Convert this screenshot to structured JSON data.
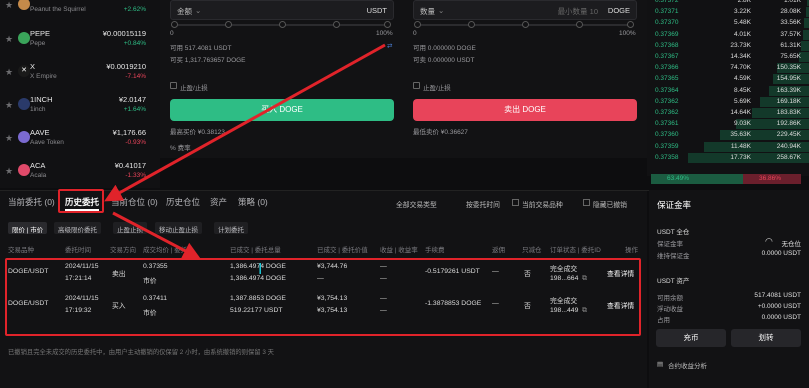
{
  "coins": [
    {
      "name": "Peanut the Squirrel",
      "symbol": "",
      "price": "",
      "change": "+2.62%",
      "color": "#c58a4a",
      "up": true
    },
    {
      "symbol": "PEPE",
      "name": "Pepe",
      "price": "¥0.00015119",
      "change": "+0.84%",
      "color": "#3aa45a",
      "up": true
    },
    {
      "symbol": "X",
      "name": "X Empire",
      "price": "¥0.0019210",
      "change": "-7.14%",
      "color": "#1a1a1a",
      "up": false
    },
    {
      "symbol": "1INCH",
      "name": "1inch",
      "price": "¥2.0147",
      "change": "+1.64%",
      "color": "#2a3a6a",
      "up": true
    },
    {
      "symbol": "AAVE",
      "name": "Aave Token",
      "price": "¥1,176.66",
      "change": "-0.93%",
      "color": "#7b6ad0",
      "up": false
    },
    {
      "symbol": "ACA",
      "name": "Acala",
      "price": "¥0.41017",
      "change": "-1.33%",
      "color": "#e04a6a",
      "up": false
    }
  ],
  "trade": {
    "buy": {
      "amount_label": "金额",
      "unit": "USDT",
      "available": "可用 517.4081 USDT",
      "can_buy": "可买 1,317.763657 DOGE",
      "pct_start": "0",
      "pct_end": "100%",
      "tpsl": "止盈/止损",
      "button": "买入 DOGE",
      "max_price": "最高买价 ¥0.38123",
      "fee": "% 费率"
    },
    "sell": {
      "qty_label": "数量",
      "hint": "最小数量 10",
      "unit": "DOGE",
      "available": "可用 0.000000 DOGE",
      "can_sell": "可卖 0.000000 USDT",
      "pct_start": "0",
      "pct_end": "100%",
      "tpsl": "止盈/止损",
      "button": "卖出 DOGE",
      "min_price": "最低卖价 ¥0.36627"
    }
  },
  "book": {
    "rows": [
      {
        "p": "0.37372",
        "q": "2.8K",
        "t": "1.01K",
        "w": 0.01
      },
      {
        "p": "0.37371",
        "q": "3.22K",
        "t": "28.08K",
        "w": 0.02
      },
      {
        "p": "0.37370",
        "q": "5.48K",
        "t": "33.56K",
        "w": 0.03
      },
      {
        "p": "0.37369",
        "q": "4.01K",
        "t": "37.57K",
        "w": 0.04
      },
      {
        "p": "0.37368",
        "q": "23.73K",
        "t": "61.31K",
        "w": 0.05
      },
      {
        "p": "0.37367",
        "q": "14.34K",
        "t": "75.65K",
        "w": 0.06
      },
      {
        "p": "0.37366",
        "q": "74.70K",
        "t": "150.35K",
        "w": 0.2
      },
      {
        "p": "0.37365",
        "q": "4.59K",
        "t": "154.95K",
        "w": 0.22
      },
      {
        "p": "0.37364",
        "q": "8.45K",
        "t": "163.39K",
        "w": 0.25
      },
      {
        "p": "0.37362",
        "q": "5.69K",
        "t": "169.18K",
        "w": 0.3
      },
      {
        "p": "0.37362",
        "q": "14.64K",
        "t": "183.83K",
        "w": 0.35
      },
      {
        "p": "0.37361",
        "q": "9.03K",
        "t": "192.86K",
        "w": 0.45
      },
      {
        "p": "0.37360",
        "q": "35.63K",
        "t": "229.45K",
        "w": 0.55
      },
      {
        "p": "0.37359",
        "q": "11.48K",
        "t": "240.94K",
        "w": 0.65
      },
      {
        "p": "0.37358",
        "q": "17.73K",
        "t": "258.67K",
        "w": 0.75
      }
    ],
    "buy_pct": "63.49%",
    "sell_pct": "36.86%"
  },
  "orders": {
    "tabs": [
      "当前委托 (0)",
      "历史委托",
      "当前仓位 (0)",
      "历史仓位",
      "资产",
      "策略 (0)"
    ],
    "filters": [
      "全部交易类型",
      "按委托时间",
      "当前交易品种",
      "隐藏已撤销"
    ],
    "chips": [
      "限价 | 市价",
      "高级限价委托",
      "止盈止损",
      "移动止盈止损",
      "计划委托"
    ],
    "headers": [
      "交易品种",
      "委托时间",
      "交易方向",
      "成交均价 | 委托价",
      "已成交 | 委托总量",
      "已成交 | 委托价值",
      "收益 | 收益率",
      "手续费",
      "返佣",
      "只减仓",
      "订单状态 | 委托ID",
      "操作"
    ],
    "rows": [
      {
        "pair": "DOGE/USDT",
        "date": "2024/11/15",
        "time": "17:21:14",
        "side": "卖出",
        "avg": "0.37355",
        "type": "市价",
        "filled": "1,386.4974 DOGE",
        "total": "1,386.4974 DOGE",
        "value": "¥3,744.76",
        "value2": "—",
        "pnl": "—",
        "pnl2": "—",
        "fee": "-0.5179261 USDT",
        "rebate": "—",
        "reduce": "否",
        "status": "完全成交",
        "id": "198...664",
        "action": "查看详情"
      },
      {
        "pair": "DOGE/USDT",
        "date": "2024/11/15",
        "time": "17:19:32",
        "side": "买入",
        "avg": "0.37411",
        "type": "市价",
        "filled": "1,387.8853 DOGE",
        "total": "519.22177 USDT",
        "value": "¥3,754.13",
        "value2": "¥3,754.13",
        "pnl": "—",
        "pnl2": "—",
        "fee": "-1.3878853 DOGE",
        "rebate": "—",
        "reduce": "否",
        "status": "完全成交",
        "id": "198...449",
        "action": "查看详情"
      }
    ],
    "footnote": "已撤销且完全未成交的历史委托中，由用户主动撤销的仅保留 2 小时，由系统撤销的则保留 3 天"
  },
  "margin": {
    "title": "保证金率",
    "usdt_full": "USDT 全仓",
    "rate_label": "保证金率",
    "rate_value": "无仓位",
    "maint_label": "维持保证金",
    "maint_value": "0.0000 USDT",
    "assets_title": "USDT 资产",
    "rows": [
      {
        "l": "可用余额",
        "v": "517.4081 USDT"
      },
      {
        "l": "浮动收益",
        "v": "+0.0000 USDT"
      },
      {
        "l": "占用",
        "v": "0.0000 USDT"
      }
    ],
    "deposit": "充币",
    "transfer": "划转",
    "analysis": "合约收益分析"
  },
  "colors": {
    "accent_buy": "#2ebd85",
    "accent_sell": "#e8445a",
    "highlight": "#e0232a"
  }
}
